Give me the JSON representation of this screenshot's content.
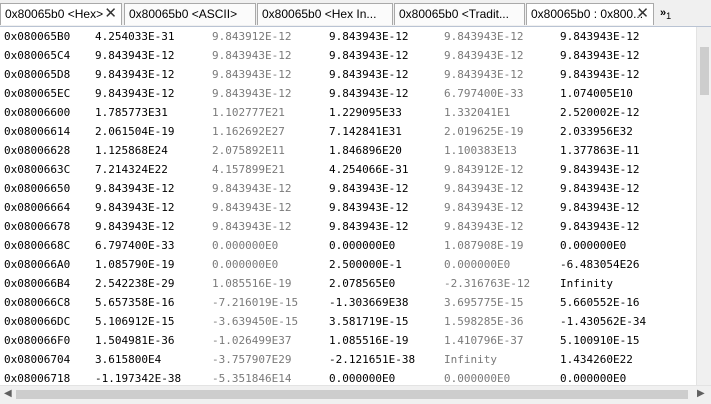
{
  "tabs": [
    {
      "label": "0x80065b0 <Hex>",
      "close": "✕"
    },
    {
      "label": "0x80065b0 <ASCII>",
      "close": ""
    },
    {
      "label": "0x80065b0 <Hex In...",
      "close": ""
    },
    {
      "label": "0x80065b0 <Tradit...",
      "close": ""
    },
    {
      "label": "0x80065b0 : 0x800...",
      "close": "✕"
    }
  ],
  "tab_overflow": {
    "label": "»",
    "count": "1"
  },
  "rows": [
    {
      "addr": "0x080065B0",
      "v": [
        "4.254033E-31",
        "9.843912E-12",
        "9.843943E-12",
        "9.843943E-12",
        "9.843943E-12"
      ]
    },
    {
      "addr": "0x080065C4",
      "v": [
        "9.843943E-12",
        "9.843943E-12",
        "9.843943E-12",
        "9.843943E-12",
        "9.843943E-12"
      ]
    },
    {
      "addr": "0x080065D8",
      "v": [
        "9.843943E-12",
        "9.843943E-12",
        "9.843943E-12",
        "9.843943E-12",
        "9.843943E-12"
      ]
    },
    {
      "addr": "0x080065EC",
      "v": [
        "9.843943E-12",
        "9.843943E-12",
        "9.843943E-12",
        "6.797400E-33",
        "1.074005E10"
      ]
    },
    {
      "addr": "0x08006600",
      "v": [
        "1.785773E31",
        "1.102777E21",
        "1.229095E33",
        "1.332041E1",
        "2.520002E-12"
      ]
    },
    {
      "addr": "0x08006614",
      "v": [
        "2.061504E-19",
        "1.162692E27",
        "7.142841E31",
        "2.019625E-19",
        "2.033956E32"
      ]
    },
    {
      "addr": "0x08006628",
      "v": [
        "1.125868E24",
        "2.075892E11",
        "1.846896E20",
        "1.100383E13",
        "1.377863E-11"
      ]
    },
    {
      "addr": "0x0800663C",
      "v": [
        "7.214324E22",
        "4.157899E21",
        "4.254066E-31",
        "9.843912E-12",
        "9.843943E-12"
      ]
    },
    {
      "addr": "0x08006650",
      "v": [
        "9.843943E-12",
        "9.843943E-12",
        "9.843943E-12",
        "9.843943E-12",
        "9.843943E-12"
      ]
    },
    {
      "addr": "0x08006664",
      "v": [
        "9.843943E-12",
        "9.843943E-12",
        "9.843943E-12",
        "9.843943E-12",
        "9.843943E-12"
      ]
    },
    {
      "addr": "0x08006678",
      "v": [
        "9.843943E-12",
        "9.843943E-12",
        "9.843943E-12",
        "9.843943E-12",
        "9.843943E-12"
      ]
    },
    {
      "addr": "0x0800668C",
      "v": [
        "6.797400E-33",
        "0.000000E0",
        "0.000000E0",
        "1.087908E-19",
        "0.000000E0"
      ]
    },
    {
      "addr": "0x080066A0",
      "v": [
        "1.085790E-19",
        "0.000000E0",
        "2.500000E-1",
        "0.000000E0",
        "-6.483054E26"
      ]
    },
    {
      "addr": "0x080066B4",
      "v": [
        "2.542238E-29",
        "1.085516E-19",
        "2.078565E0",
        "-2.316763E-12",
        "Infinity"
      ]
    },
    {
      "addr": "0x080066C8",
      "v": [
        "5.657358E-16",
        "-7.216019E-15",
        "-1.303669E38",
        "3.695775E-15",
        "5.660552E-16"
      ]
    },
    {
      "addr": "0x080066DC",
      "v": [
        "5.106912E-15",
        "-3.639450E-15",
        "3.581719E-15",
        "1.598285E-36",
        "-1.430562E-34"
      ]
    },
    {
      "addr": "0x080066F0",
      "v": [
        "1.504981E-36",
        "-1.026499E37",
        "1.085516E-19",
        "1.410796E-37",
        "5.100910E-15"
      ]
    },
    {
      "addr": "0x08006704",
      "v": [
        "3.615800E4",
        "-3.757907E29",
        "-2.121651E-38",
        "Infinity",
        "1.434260E22"
      ]
    },
    {
      "addr": "0x08006718",
      "v": [
        "-1.197342E-38",
        "-5.351846E14",
        "0.000000E0",
        "0.000000E0",
        "0.000000E0"
      ]
    }
  ],
  "scrollbar": {
    "left_arrow": "◀",
    "right_arrow": "▶"
  }
}
